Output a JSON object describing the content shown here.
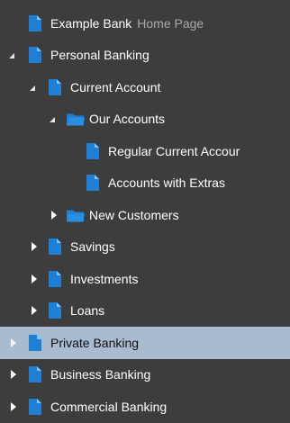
{
  "colors": {
    "background": "#3d3d3d",
    "selection": "#a9bbd1",
    "page_icon": "#1e7fd4",
    "folder_icon": "#2a8ee0"
  },
  "tree": {
    "items": [
      {
        "label": "Example Bank",
        "suffix": "Home Page",
        "icon": "page-icon",
        "toggle": "none"
      },
      {
        "label": "Personal Banking",
        "icon": "page-icon",
        "toggle": "expanded"
      },
      {
        "label": "Current Account",
        "icon": "page-icon",
        "toggle": "expanded"
      },
      {
        "label": "Our Accounts",
        "icon": "folder-open-icon",
        "toggle": "expanded"
      },
      {
        "label": "Regular Current Accour",
        "icon": "page-icon",
        "toggle": "none"
      },
      {
        "label": "Accounts with Extras",
        "icon": "page-icon",
        "toggle": "none"
      },
      {
        "label": "New Customers",
        "icon": "folder-open-icon",
        "toggle": "collapsed"
      },
      {
        "label": "Savings",
        "icon": "page-icon",
        "toggle": "collapsed"
      },
      {
        "label": "Investments",
        "icon": "page-icon",
        "toggle": "collapsed"
      },
      {
        "label": "Loans",
        "icon": "page-icon",
        "toggle": "collapsed"
      },
      {
        "label": "Private Banking",
        "icon": "page-icon",
        "toggle": "collapsed",
        "selected": true
      },
      {
        "label": "Business Banking",
        "icon": "page-icon",
        "toggle": "collapsed"
      },
      {
        "label": "Commercial Banking",
        "icon": "page-icon",
        "toggle": "collapsed"
      }
    ]
  }
}
